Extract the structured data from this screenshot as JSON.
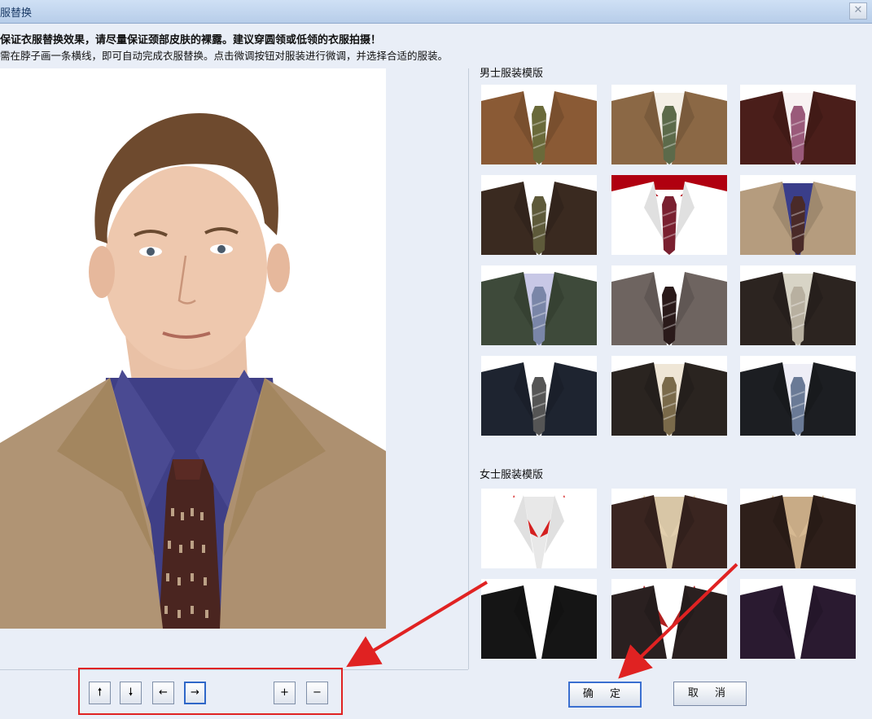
{
  "window": {
    "title": "服替换",
    "close_glyph": "✕"
  },
  "instructions": {
    "line1": "保证衣服替换效果，请尽量保证颈部皮肤的裸露。建议穿圆领或低领的衣服拍摄！",
    "line2": "需在脖子画一条横线，即可自动完成衣服替换。点击微调按钮对服装进行微调，并选择合适的服装。"
  },
  "sections": {
    "male": "男士服装模版",
    "female": "女士服装模版"
  },
  "male_templates": [
    {
      "suit": "#8a5a35",
      "shirt": "#ffffff",
      "tie": "#6a6a3a"
    },
    {
      "suit": "#8b6845",
      "shirt": "#f4efe6",
      "tie": "#5c6a4a"
    },
    {
      "suit": "#4a1e1a",
      "shirt": "#f8f2f2",
      "tie": "#9a5a7a"
    },
    {
      "suit": "#3a2a20",
      "shirt": "#ffffff",
      "tie": "#5e5a3a"
    },
    {
      "suit": "#ffffff",
      "shirt": "#ffffff",
      "tie": "#7a2030",
      "collar": "#b00010"
    },
    {
      "suit": "#b59c7e",
      "shirt": "#3a3e8a",
      "tie": "#4a2a28"
    },
    {
      "suit": "#3e4a3a",
      "shirt": "#c8c8e6",
      "tie": "#7a86a8"
    },
    {
      "suit": "#6e6460",
      "shirt": "#ffffff",
      "tie": "#2a1a1a"
    },
    {
      "suit": "#2c2420",
      "shirt": "#d8d4c6",
      "tie": "#b8b0a0"
    },
    {
      "suit": "#1e2430",
      "shirt": "#ffffff",
      "tie": "#555555"
    },
    {
      "suit": "#2a2420",
      "shirt": "#efe6d6",
      "tie": "#7a6a4a"
    },
    {
      "suit": "#1c1e22",
      "shirt": "#eeeef6",
      "tie": "#6a7a96"
    }
  ],
  "female_templates": [
    {
      "suit": "#ffffff",
      "shirt": "#e8e8e8",
      "collar": "#d42020"
    },
    {
      "suit": "#3a2520",
      "shirt": "#d8c6a6",
      "collar": "#e2cfae"
    },
    {
      "suit": "#2e1f1a",
      "shirt": "#c8ab86",
      "collar": "#d6b992"
    },
    {
      "suit": "#151515",
      "shirt": "#ffffff",
      "collar": "#ffffff"
    },
    {
      "suit": "#2a2020",
      "shirt": "#ffffff",
      "collar": "#b02020"
    },
    {
      "suit": "#2a1a30",
      "shirt": "#ffffff",
      "collar": "#ffffff"
    }
  ],
  "controls": {
    "up": "🠕",
    "down": "🠗",
    "left": "←",
    "right": "→",
    "zoom_in": "+",
    "zoom_out": "−"
  },
  "buttons": {
    "ok": "确 定",
    "cancel": "取 消"
  },
  "colors": {
    "highlight_red": "#e02222",
    "accent_blue": "#2f67c8"
  }
}
